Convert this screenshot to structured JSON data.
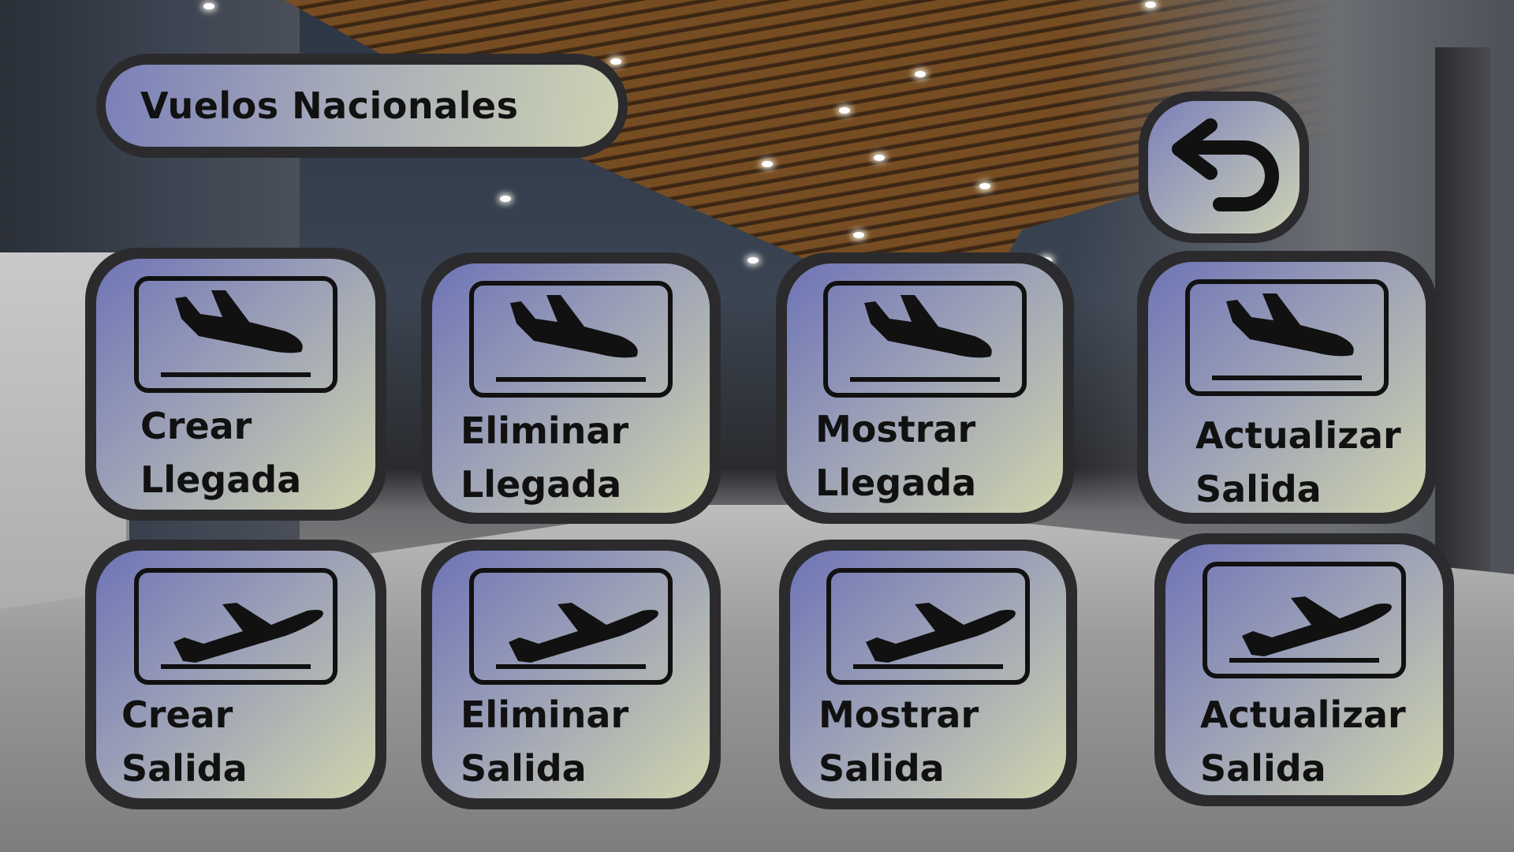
{
  "header": {
    "title": "Vuelos Nacionales"
  },
  "back": {
    "icon": "undo-arrow-icon"
  },
  "tiles_row1": [
    {
      "line1": "Crear",
      "line2": "Llegada",
      "icon": "plane-arrival-icon"
    },
    {
      "line1": "Eliminar",
      "line2": "Llegada",
      "icon": "plane-arrival-icon"
    },
    {
      "line1": "Mostrar",
      "line2": "Llegada",
      "icon": "plane-arrival-icon"
    },
    {
      "line1": "Actualizar",
      "line2": "Salida",
      "icon": "plane-arrival-icon"
    }
  ],
  "tiles_row2": [
    {
      "line1": "Crear",
      "line2": "Salida",
      "icon": "plane-departure-icon"
    },
    {
      "line1": "Eliminar",
      "line2": "Salida",
      "icon": "plane-departure-icon"
    },
    {
      "line1": "Mostrar",
      "line2": "Salida",
      "icon": "plane-departure-icon"
    },
    {
      "line1": "Actualizar",
      "line2": "Salida",
      "icon": "plane-departure-icon"
    }
  ],
  "colors": {
    "frame": "#2b2b2e",
    "gradient_start": "#6e74b6",
    "gradient_end": "#cfd4ad",
    "ceiling": "#7a4e21"
  }
}
